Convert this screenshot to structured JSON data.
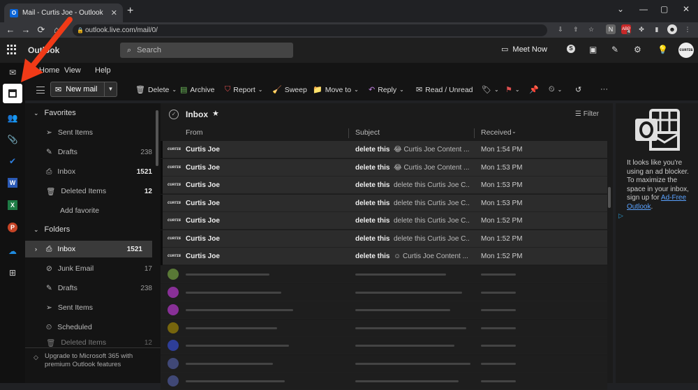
{
  "browser": {
    "tab_title": "Mail - Curtis Joe - Outlook",
    "tab_favicon": "O",
    "close_glyph": "✕",
    "newtab_glyph": "+",
    "url": "outlook.live.com/mail/0/",
    "controls": {
      "chevron": "⌄",
      "minimize": "—",
      "maximize": "▢",
      "close": "✕"
    },
    "nav": {
      "back": "←",
      "forward": "→",
      "reload": "⟳",
      "home": "⌂"
    },
    "ext_badge": "4"
  },
  "header": {
    "brand": "Outlook",
    "search_placeholder": "Search",
    "meet_label": "Meet Now",
    "avatar_text": "ᴄᴜʀᴛɪꜱ"
  },
  "menu": {
    "tabs": [
      "Home",
      "View",
      "Help"
    ]
  },
  "toolbar": {
    "new_mail": "New mail",
    "delete": "Delete",
    "archive": "Archive",
    "report": "Report",
    "sweep": "Sweep",
    "move_to": "Move to",
    "reply": "Reply",
    "read_unread": "Read / Unread"
  },
  "sidebar": {
    "favorites_header": "Favorites",
    "favorites": [
      {
        "label": "Sent Items",
        "count": ""
      },
      {
        "label": "Drafts",
        "count": "238"
      },
      {
        "label": "Inbox",
        "count": "1521"
      },
      {
        "label": "Deleted Items",
        "count": "12"
      }
    ],
    "add_favorite": "Add favorite",
    "folders_header": "Folders",
    "folders": [
      {
        "label": "Inbox",
        "count": "1521"
      },
      {
        "label": "Junk Email",
        "count": "17"
      },
      {
        "label": "Drafts",
        "count": "238"
      },
      {
        "label": "Sent Items",
        "count": ""
      },
      {
        "label": "Scheduled",
        "count": ""
      },
      {
        "label": "Deleted Items",
        "count": "12"
      }
    ],
    "upgrade": "Upgrade to Microsoft 365 with premium Outlook features"
  },
  "list": {
    "title": "Inbox",
    "filter": "Filter",
    "columns": {
      "from": "From",
      "subject": "Subject",
      "received": "Received"
    },
    "rows": [
      {
        "from": "Curtis Joe",
        "subject": "delete this",
        "preview": "😂 Curtis Joe Content ...",
        "time": "Mon 1:54 PM"
      },
      {
        "from": "Curtis Joe",
        "subject": "delete this",
        "preview": "😂 Curtis Joe Content ...",
        "time": "Mon 1:53 PM"
      },
      {
        "from": "Curtis Joe",
        "subject": "delete this",
        "preview": "delete this Curtis Joe C...",
        "time": "Mon 1:53 PM"
      },
      {
        "from": "Curtis Joe",
        "subject": "delete this",
        "preview": "delete this Curtis Joe C...",
        "time": "Mon 1:53 PM"
      },
      {
        "from": "Curtis Joe",
        "subject": "delete this",
        "preview": "delete this Curtis Joe C...",
        "time": "Mon 1:52 PM"
      },
      {
        "from": "Curtis Joe",
        "subject": "delete this",
        "preview": "delete this Curtis Joe C...",
        "time": "Mon 1:52 PM"
      },
      {
        "from": "Curtis Joe",
        "subject": "delete this",
        "preview": "☺ Curtis Joe Content ...",
        "time": "Mon 1:52 PM"
      }
    ],
    "avatar_sig": "ᴄᴜʀᴛɪꜱ",
    "blurred_dot_colors": [
      "#8bc34a",
      "#e040fb",
      "#e040fb",
      "#c0a000",
      "#3d5afe",
      "#5c6bc0",
      "#5c6bc0"
    ]
  },
  "ad": {
    "text": "It looks like you're using an ad blocker. To maximize the space in your inbox, sign up for ",
    "link": "Ad-Free Outlook",
    "end": "."
  },
  "colors": {
    "outlook_blue": "#0a64d6",
    "annotation_arrow": "#f03a17"
  }
}
